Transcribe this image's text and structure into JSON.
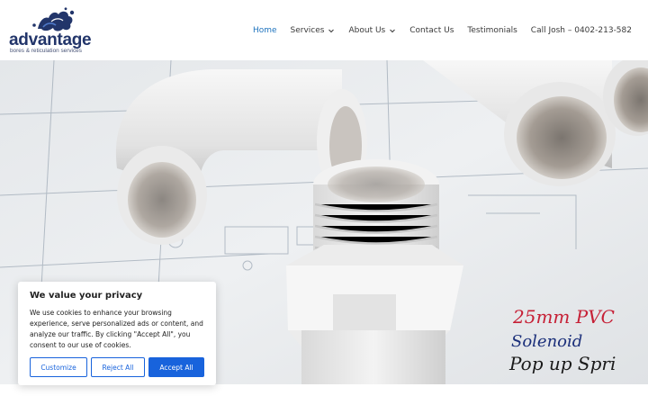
{
  "brand": {
    "name": "advantage",
    "tagline": "bores & reticulation services"
  },
  "nav": {
    "items": [
      {
        "label": "Home",
        "active": true
      },
      {
        "label": "Services",
        "dropdown": true
      },
      {
        "label": "About Us",
        "dropdown": true
      },
      {
        "label": "Contact Us"
      },
      {
        "label": "Testimonials"
      },
      {
        "label": "Call Josh – 0402-213-582"
      }
    ]
  },
  "hero": {
    "handwriting": [
      "25mm PVC",
      "Solenoid",
      "Pop up Spri"
    ]
  },
  "cookie": {
    "title": "We value your privacy",
    "text": "We use cookies to enhance your browsing experience, serve personalized ads or content, and analyze our traffic. By clicking \"Accept All\", you consent to our use of cookies.",
    "buttons": {
      "customize": "Customize",
      "reject": "Reject All",
      "accept": "Accept All"
    }
  },
  "colors": {
    "accent": "#1e73be",
    "brand": "#22356a",
    "button": "#1863dc"
  }
}
